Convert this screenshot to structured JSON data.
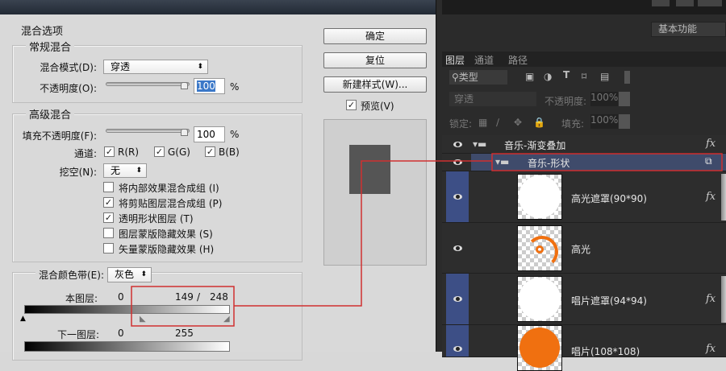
{
  "dialog": {
    "section_title": "混合选项",
    "general": {
      "title": "常规混合",
      "blend_mode_label": "混合模式(D):",
      "blend_mode_value": "穿透",
      "opacity_label": "不透明度(O):",
      "opacity_value": "100",
      "percent": "%",
      "opacity_fraction": 1.0
    },
    "advanced": {
      "title": "高级混合",
      "fill_label": "填充不透明度(F):",
      "fill_value": "100",
      "percent": "%",
      "channels_label": "通道:",
      "channels": [
        {
          "label": "R(R)",
          "checked": true
        },
        {
          "label": "G(G)",
          "checked": true
        },
        {
          "label": "B(B)",
          "checked": true
        }
      ],
      "knockout_label": "挖空(N):",
      "knockout_value": "无",
      "options": [
        {
          "label": "将内部效果混合成组 (I)",
          "checked": false
        },
        {
          "label": "将剪贴图层混合成组 (P)",
          "checked": true
        },
        {
          "label": "透明形状图层 (T)",
          "checked": true
        },
        {
          "label": "图层蒙版隐藏效果 (S)",
          "checked": false
        },
        {
          "label": "矢量蒙版隐藏效果 (H)",
          "checked": false
        }
      ]
    },
    "blend_if": {
      "label": "混合颜色带(E):",
      "value": "灰色",
      "this_layer_label": "本图层:",
      "this_layer_black": "0",
      "this_layer_white_low": "149",
      "slash": "/",
      "this_layer_white_high": "248",
      "underlying_label": "下一图层:",
      "underlying_black": "0",
      "underlying_white": "255"
    },
    "buttons": {
      "ok": "确定",
      "reset": "复位",
      "new_style": "新建样式(W)...",
      "preview": "预览(V)",
      "preview_checked": true
    }
  },
  "panel": {
    "workspace": "基本功能",
    "tabs": [
      "图层",
      "通道",
      "路径"
    ],
    "filter_type": "类型",
    "blend_mode": "穿透",
    "opacity_label": "不透明度:",
    "opacity_value": "100%",
    "lock_label": "锁定:",
    "fill_label": "填充:",
    "fill_value": "100%",
    "layers": [
      {
        "name": "音乐-渐变叠加",
        "type": "group",
        "fx": "fx"
      },
      {
        "name": "音乐-形状",
        "type": "group",
        "selected": true
      },
      {
        "name": "高光遮罩(90*90)",
        "fx": "fx"
      },
      {
        "name": "高光"
      },
      {
        "name": "唱片遮罩(94*94)",
        "fx": "fx"
      },
      {
        "name": "唱片(108*108)",
        "fx": "fx"
      }
    ]
  },
  "colors": {
    "highlight": "#d03030",
    "selection_blue": "#3d4f86",
    "orange": "#f07010"
  }
}
